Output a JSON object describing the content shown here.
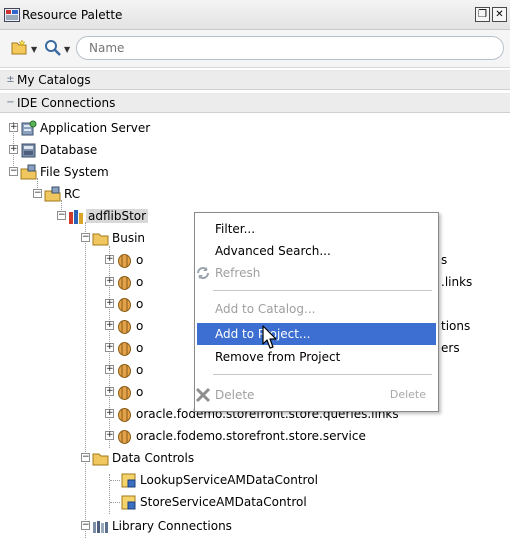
{
  "window": {
    "title": "Resource Palette"
  },
  "toolbar": {
    "search_placeholder": "Name"
  },
  "sections": {
    "my_catalogs": "My Catalogs",
    "ide_connections": "IDE Connections"
  },
  "tree": {
    "app_server": "Application Server",
    "database": "Database",
    "file_system": "File System",
    "rc": "RC",
    "adflib": "adflibStor",
    "business": "Busin",
    "pkg_prefix": "o",
    "pkg_tail_1": "s",
    "pkg_tail_2": ".links",
    "pkg_tail_4": "tions",
    "pkg_tail_5": "ers",
    "queries_links": "oracle.fodemo.storefront.store.queries.links",
    "store_service": "oracle.fodemo.storefront.store.service",
    "data_controls": "Data Controls",
    "lookup_dc": "LookupServiceAMDataControl",
    "store_dc": "StoreServiceAMDataControl",
    "library_connections": "Library Connections"
  },
  "menu": {
    "filter": "Filter...",
    "advanced_search": "Advanced Search...",
    "refresh": "Refresh",
    "add_to_catalog": "Add to Catalog...",
    "add_to_project": "Add to Project...",
    "remove_from_project": "Remove from Project",
    "delete": "Delete",
    "delete_accel": "Delete"
  },
  "colors": {
    "highlight": "#3c6fd1",
    "selection": "#d8d8d8",
    "folder": "#f0c75e",
    "package": "#c98a2e"
  }
}
